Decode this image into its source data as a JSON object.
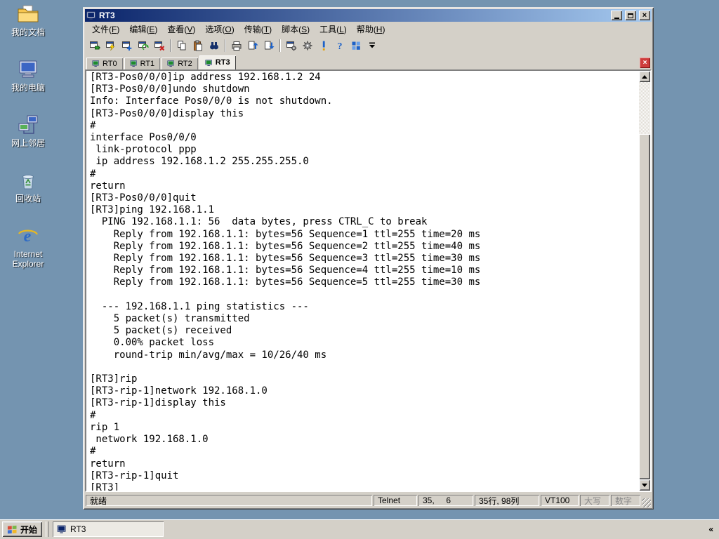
{
  "colors": {
    "desktop": "#7494B0",
    "chrome": "#D4D0C8",
    "titlebar_start": "#0A246A",
    "titlebar_end": "#A6CAF0",
    "terminal_bg": "#FFFFFF",
    "terminal_fg": "#000000",
    "tab_close_red": "#CE3C3C"
  },
  "desktop": {
    "icons": [
      {
        "name": "my-documents",
        "label": "我的文档"
      },
      {
        "name": "my-computer",
        "label": "我的电脑"
      },
      {
        "name": "network-places",
        "label": "网上邻居"
      },
      {
        "name": "recycle-bin",
        "label": "回收站"
      },
      {
        "name": "internet-explorer",
        "label": "Internet Explorer"
      }
    ]
  },
  "window": {
    "title": "RT3",
    "controls": [
      "minimize",
      "maximize",
      "close"
    ],
    "menu": {
      "items": [
        "文件(F)",
        "编辑(E)",
        "查看(V)",
        "选项(O)",
        "传输(T)",
        "脚本(S)",
        "工具(L)",
        "帮助(H)"
      ]
    },
    "toolbar": {
      "buttons": [
        "connect",
        "quick-connect",
        "new-session",
        "reconnect",
        "disconnect",
        "copy",
        "paste",
        "find",
        "print",
        "upload",
        "download",
        "session-options",
        "global-options",
        "trace-options",
        "help",
        "session-manager",
        "toolbar-overflow"
      ]
    },
    "tabs": [
      {
        "label": "RT0",
        "active": false
      },
      {
        "label": "RT1",
        "active": false
      },
      {
        "label": "RT2",
        "active": false
      },
      {
        "label": "RT3",
        "active": true
      }
    ],
    "tab_close": "×",
    "terminal": {
      "lines": [
        "[RT3-Pos0/0/0]ip address 192.168.1.2 24",
        "[RT3-Pos0/0/0]undo shutdown",
        "Info: Interface Pos0/0/0 is not shutdown.",
        "[RT3-Pos0/0/0]display this",
        "#",
        "interface Pos0/0/0",
        " link-protocol ppp",
        " ip address 192.168.1.2 255.255.255.0",
        "#",
        "return",
        "[RT3-Pos0/0/0]quit",
        "[RT3]ping 192.168.1.1",
        "  PING 192.168.1.1: 56  data bytes, press CTRL_C to break",
        "    Reply from 192.168.1.1: bytes=56 Sequence=1 ttl=255 time=20 ms",
        "    Reply from 192.168.1.1: bytes=56 Sequence=2 ttl=255 time=40 ms",
        "    Reply from 192.168.1.1: bytes=56 Sequence=3 ttl=255 time=30 ms",
        "    Reply from 192.168.1.1: bytes=56 Sequence=4 ttl=255 time=10 ms",
        "    Reply from 192.168.1.1: bytes=56 Sequence=5 ttl=255 time=30 ms",
        "",
        "  --- 192.168.1.1 ping statistics ---",
        "    5 packet(s) transmitted",
        "    5 packet(s) received",
        "    0.00% packet loss",
        "    round-trip min/avg/max = 10/26/40 ms",
        "",
        "[RT3]rip",
        "[RT3-rip-1]network 192.168.1.0",
        "[RT3-rip-1]display this",
        "#",
        "rip 1",
        " network 192.168.1.0",
        "#",
        "return",
        "[RT3-rip-1]quit",
        "[RT3]"
      ]
    },
    "statusbar": {
      "ready": "就绪",
      "protocol": "Telnet",
      "cursor": "35,     6",
      "size": "35行, 98列",
      "emulation": "VT100",
      "caps_lock": "大写",
      "num_lock": "数字"
    }
  },
  "taskbar": {
    "start_label": "开始",
    "tasks": [
      {
        "label": "RT3"
      }
    ],
    "collapse": "«"
  }
}
